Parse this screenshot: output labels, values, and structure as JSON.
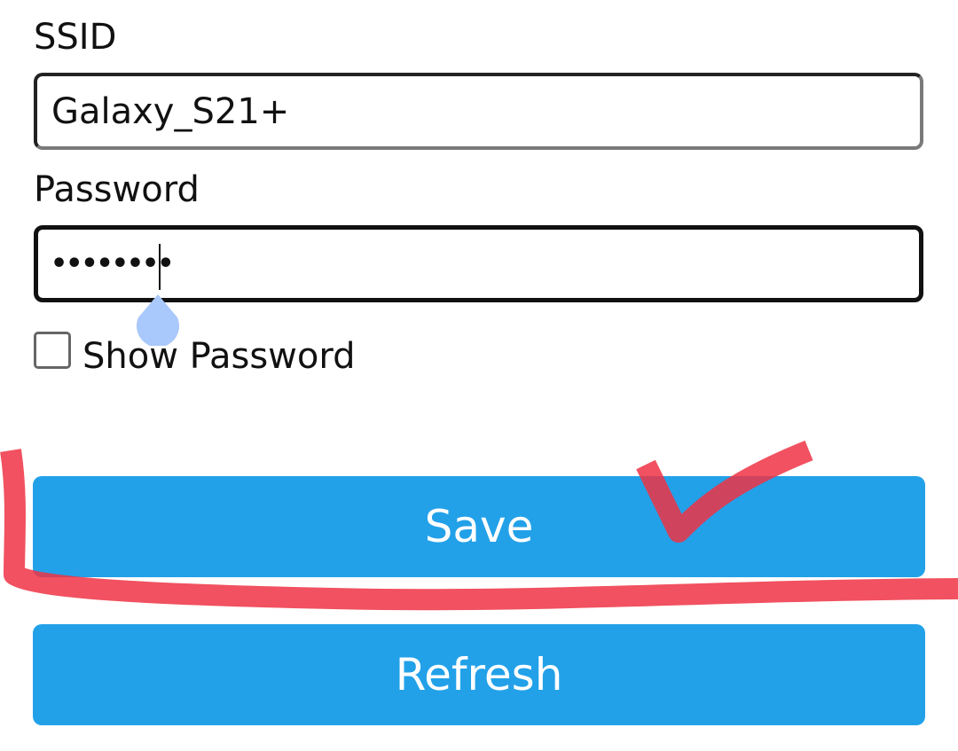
{
  "form": {
    "ssid_label": "SSID",
    "ssid_value": "Galaxy_S21+",
    "password_label": "Password",
    "password_value": "••••••••",
    "show_password_label": "Show Password",
    "show_password_checked": false
  },
  "buttons": {
    "save_label": "Save",
    "refresh_label": "Refresh"
  },
  "colors": {
    "button_background": "#22a1e9",
    "button_text": "#ffffff",
    "annotation_stroke": "#ee3344",
    "caret_handle": "#a9c8fb"
  }
}
